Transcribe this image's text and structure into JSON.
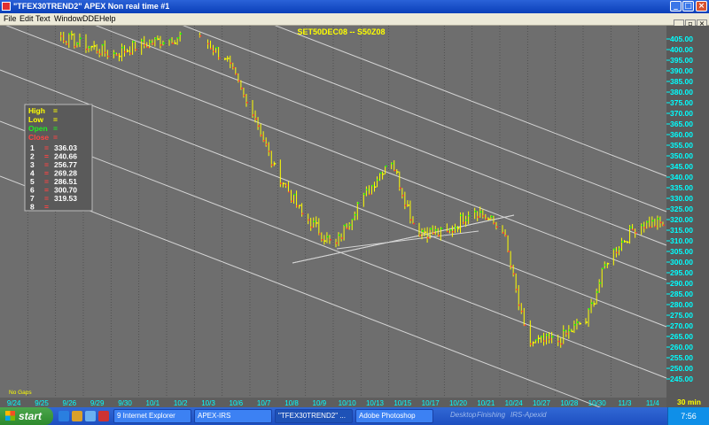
{
  "window": {
    "title": "\"TFEX30TREND2\" APEX Non real time #1"
  },
  "menu": {
    "file": "File",
    "edit": "Edit",
    "text": "Text",
    "window": "Window",
    "dde": "DDE",
    "help": "Help"
  },
  "chart_title": "SET50DEC08 -- S50Z08",
  "info": {
    "high": "High",
    "low": "Low",
    "open": "Open",
    "close": "Close",
    "eq": "=",
    "rows": [
      {
        "n": "1",
        "v": "336.03"
      },
      {
        "n": "2",
        "v": "240.66"
      },
      {
        "n": "3",
        "v": "256.77"
      },
      {
        "n": "4",
        "v": "269.28"
      },
      {
        "n": "5",
        "v": "286.51"
      },
      {
        "n": "6",
        "v": "300.70"
      },
      {
        "n": "7",
        "v": "319.53"
      },
      {
        "n": "8",
        "v": ""
      }
    ]
  },
  "no_gaps": "No Gaps",
  "interval": "30 min",
  "chart_data": {
    "type": "bar",
    "yticks": [
      245,
      250,
      255,
      260,
      265,
      270,
      275,
      280,
      285,
      290,
      295,
      300,
      305,
      310,
      315,
      320,
      325,
      330,
      335,
      340,
      345,
      350,
      355,
      360,
      365,
      370,
      375,
      380,
      385,
      390,
      395,
      400,
      405
    ],
    "ytick_labels": [
      "245.00",
      "250.00",
      "255.00",
      "260.00",
      "265.00",
      "270.00",
      "275.00",
      "280.00",
      "285.00",
      "290.00",
      "295.00",
      "300.00",
      "305.00",
      "310.00",
      "315.00",
      "320.00",
      "325.00",
      "330.00",
      "335.00",
      "340.00",
      "345.00",
      "350.00",
      "355.00",
      "360.00",
      "365.00",
      "370.00",
      "375.00",
      "380.00",
      "385.00",
      "390.00",
      "395.00",
      "400.00",
      "405.00"
    ],
    "ylim": [
      241,
      409
    ],
    "dates": [
      "9/24",
      "9/25",
      "9/26",
      "9/29",
      "9/30",
      "10/1",
      "10/2",
      "10/3",
      "10/6",
      "10/7",
      "10/8",
      "10/9",
      "10/10",
      "10/13",
      "10/15",
      "10/17",
      "10/20",
      "10/21",
      "10/24",
      "10/27",
      "10/28",
      "10/30",
      "11/3",
      "11/4"
    ],
    "closes": [
      417,
      412,
      407,
      402,
      398,
      402,
      405,
      408,
      397,
      372,
      340,
      320,
      308,
      330,
      348,
      315,
      313,
      325,
      316,
      262,
      263,
      272,
      305,
      318
    ],
    "colors": {
      "up": "#00ff00",
      "down": "#ff3030",
      "neutral": "#ffff00",
      "channel": "#d4d4d4",
      "axis": "#00ffff",
      "title": "#ffff00"
    }
  },
  "taskbar": {
    "start": "start",
    "tasks": [
      "9 Internet Explorer",
      "APEX-IRS",
      "\"TFEX30TREND2\" ...",
      "Adobe Photoshop"
    ],
    "ghost": [
      "Desktop",
      "Finishing",
      "IRS-Apexid"
    ],
    "clock": "7:56"
  }
}
